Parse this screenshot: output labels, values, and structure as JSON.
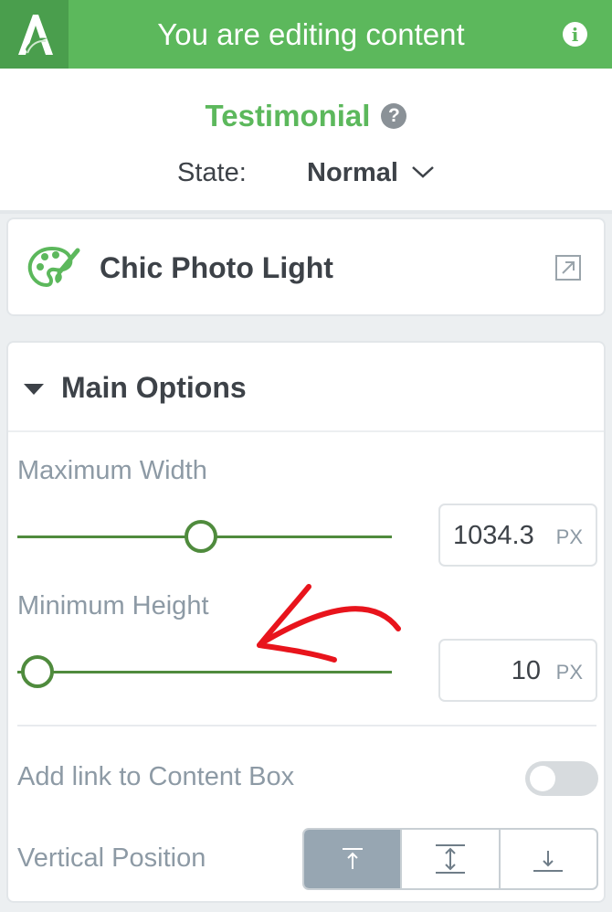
{
  "topbar": {
    "title": "You are editing content",
    "colors": {
      "brand": "#5cb85c",
      "logo_bg": "#4a9e4d"
    },
    "logo_icon": "logo-icon",
    "info_icon": "info-icon",
    "info_glyph": "i"
  },
  "header": {
    "widget_title": "Testimonial",
    "help_glyph": "?",
    "state_label": "State:",
    "state_value": "Normal"
  },
  "style_card": {
    "name": "Chic Photo Light",
    "icon": "palette-icon",
    "link_icon": "external-link-icon"
  },
  "options": {
    "title": "Main Options",
    "max_width": {
      "label": "Maximum Width",
      "value": "1034.3",
      "unit": "PX",
      "slider_fraction": 0.49
    },
    "min_height": {
      "label": "Minimum Height",
      "value": "10",
      "unit": "PX",
      "slider_fraction": 0.06
    },
    "add_link": {
      "label": "Add link to Content Box",
      "enabled": false
    },
    "vertical_position": {
      "label": "Vertical Position",
      "options": [
        "top",
        "middle",
        "bottom"
      ],
      "selected": "top"
    }
  },
  "colors": {
    "slider": "#4f8b3d",
    "label_gray": "#8d9aa5",
    "annotation": "#e8141c"
  }
}
